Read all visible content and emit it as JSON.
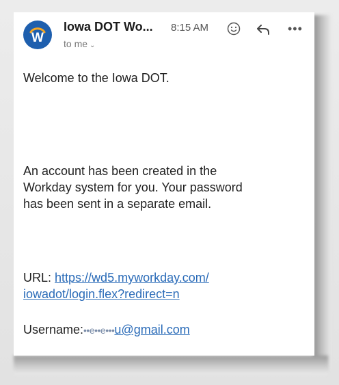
{
  "email": {
    "sender": "Iowa DOT Wo...",
    "avatar_letter": "W",
    "time": "8:15 AM",
    "recipient": "to me",
    "greeting": "Welcome to the Iowa DOT.",
    "body_lines": [
      "An account has been created in the",
      "Workday system for you. Your password",
      "has been sent in a separate email."
    ],
    "url_label": "URL:",
    "url_line1": "https://wd5.myworkday.com/",
    "url_line2": "iowadot/login.flex?redirect=n",
    "username_label": "Username:",
    "username_obscured": "••e••e•••",
    "username_visible": "u@gmail.com"
  },
  "icons": {
    "avatar": "workday-logo-icon",
    "emoji": "emoji-reaction-icon",
    "reply": "reply-icon",
    "more": "more-options-icon",
    "recipient_chevron": "chevron-down-icon"
  },
  "colors": {
    "avatar_bg": "#1e5fae",
    "link": "#2a6bb8"
  }
}
